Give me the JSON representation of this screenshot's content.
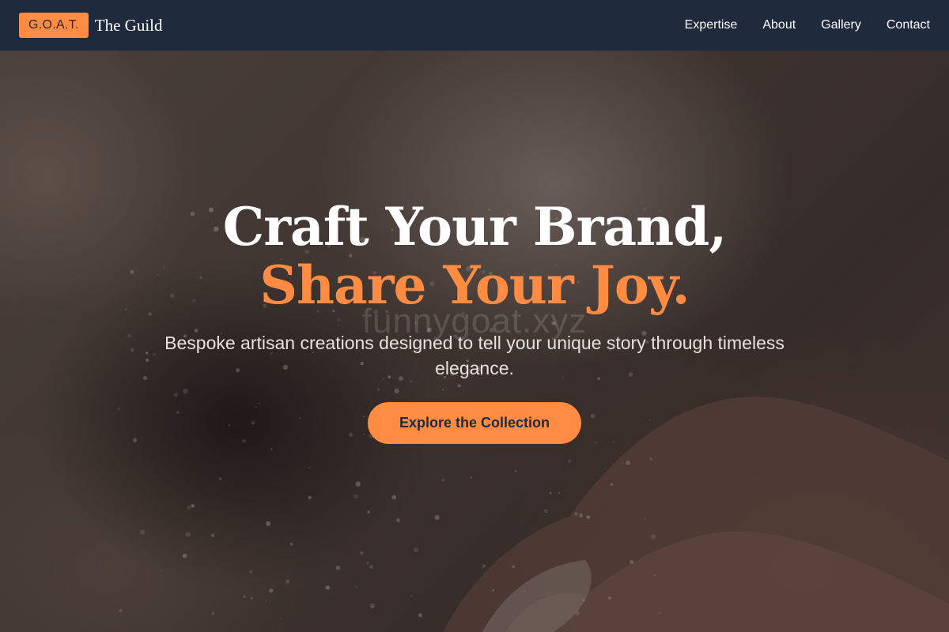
{
  "header": {
    "logo_badge": "G.O.A.T.",
    "brand_name": "The Guild",
    "nav": [
      {
        "label": "Expertise"
      },
      {
        "label": "About"
      },
      {
        "label": "Gallery"
      },
      {
        "label": "Contact"
      }
    ]
  },
  "hero": {
    "headline_line1": "Craft Your Brand,",
    "headline_line2": "Share Your Joy.",
    "subtitle": "Bespoke artisan creations designed to tell your unique story through timeless elegance.",
    "watermark": "funnygoat.xyz",
    "cta_label": "Explore the Collection"
  },
  "colors": {
    "accent": "#ff8c42",
    "navbar": "#1f2a3c",
    "text_light": "#ffffff"
  }
}
